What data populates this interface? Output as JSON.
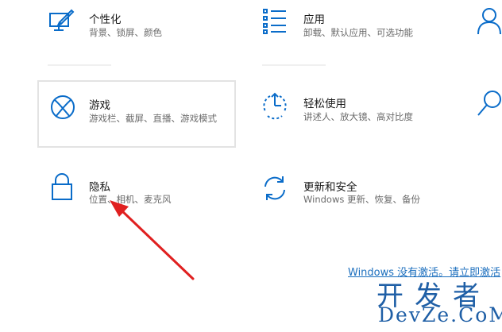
{
  "accent_color": "#0a6cc9",
  "tiles": [
    {
      "id": "personalization",
      "title": "个性化",
      "desc": "背景、锁屏、颜色",
      "icon": "personalization-icon"
    },
    {
      "id": "apps",
      "title": "应用",
      "desc": "卸载、默认应用、可选功能",
      "icon": "apps-list-icon"
    },
    {
      "id": "gaming",
      "title": "游戏",
      "desc": "游戏栏、截屏、直播、游戏模式",
      "icon": "xbox-icon"
    },
    {
      "id": "ease-of-access",
      "title": "轻松使用",
      "desc": "讲述人、放大镜、高对比度",
      "icon": "ease-of-access-icon"
    },
    {
      "id": "privacy",
      "title": "隐私",
      "desc": "位置、相机、麦克风",
      "icon": "lock-icon"
    },
    {
      "id": "update",
      "title": "更新和安全",
      "desc": "Windows 更新、恢复、备份",
      "icon": "refresh-icon"
    }
  ],
  "activation_link": "Windows 没有激活。请立即激活",
  "watermark": {
    "cn": "开发者",
    "en": "DevZe.CoM"
  }
}
